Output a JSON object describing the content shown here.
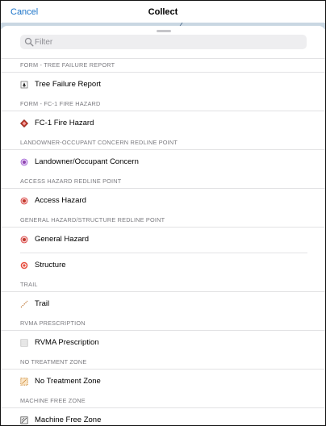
{
  "header": {
    "cancel_label": "Cancel",
    "title": "Collect"
  },
  "search": {
    "placeholder": "Filter",
    "value": ""
  },
  "sections": [
    {
      "header": "FORM - TREE FAILURE REPORT",
      "items": [
        {
          "label": "Tree Failure Report",
          "icon": "tree-failure-report-icon"
        }
      ]
    },
    {
      "header": "FORM - FC-1 FIRE HAZARD",
      "items": [
        {
          "label": "FC-1 Fire Hazard",
          "icon": "fire-hazard-diamond-icon"
        }
      ]
    },
    {
      "header": "LANDOWNER-OCCUPANT CONCERN REDLINE POINT",
      "items": [
        {
          "label": "Landowner/Occupant Concern",
          "icon": "purple-point-icon"
        }
      ]
    },
    {
      "header": "ACCESS HAZARD REDLINE POINT",
      "items": [
        {
          "label": "Access Hazard",
          "icon": "red-point-icon"
        }
      ]
    },
    {
      "header": "GENERAL HAZARD/STRUCTURE REDLINE POINT",
      "items": [
        {
          "label": "General Hazard",
          "icon": "red-point-icon"
        },
        {
          "label": "Structure",
          "icon": "target-point-icon"
        }
      ]
    },
    {
      "header": "TRAIL",
      "items": [
        {
          "label": "Trail",
          "icon": "dashed-line-icon"
        }
      ]
    },
    {
      "header": "RVMA PRESCRIPTION",
      "items": [
        {
          "label": "RVMA Prescription",
          "icon": "hatched-polygon-icon"
        }
      ]
    },
    {
      "header": "NO TREATMENT ZONE",
      "items": [
        {
          "label": "No Treatment Zone",
          "icon": "dashed-polygon-icon"
        }
      ]
    },
    {
      "header": "MACHINE FREE ZONE",
      "items": [
        {
          "label": "Machine Free Zone",
          "icon": "diagonal-polygon-icon"
        }
      ]
    }
  ],
  "colors": {
    "accent": "#1a73c9",
    "red_point": "#d93a3a",
    "purple_point": "#9b59d0"
  }
}
